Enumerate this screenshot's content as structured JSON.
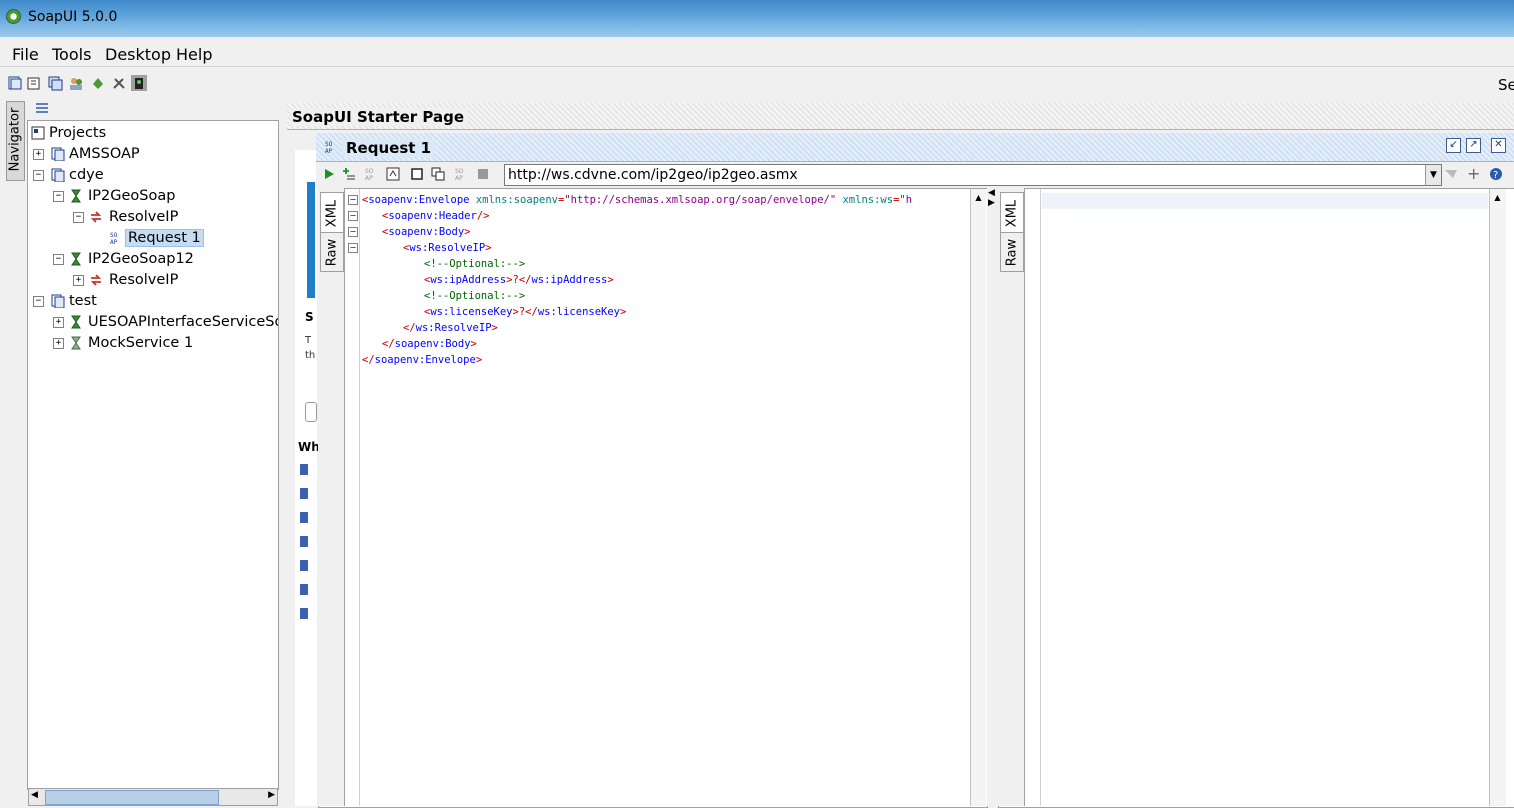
{
  "app": {
    "title": "SoapUI 5.0.0"
  },
  "menu": {
    "file": "File",
    "tools": "Tools",
    "desktop": "Desktop",
    "help": "Help"
  },
  "toolbar": {
    "search_label": "Se"
  },
  "navigator": {
    "tab_label": "Navigator",
    "root": "Projects",
    "nodes": {
      "amssoap": "AMSSOAP",
      "cdye": "cdye",
      "ip2geosoap": "IP2GeoSoap",
      "resolveip": "ResolveIP",
      "request1": "Request 1",
      "ip2geosoap12": "IP2GeoSoap12",
      "resolveip12": "ResolveIP",
      "test": "test",
      "uesoap": "UESOAPInterfaceServiceSoap",
      "mock": "MockService 1"
    }
  },
  "starter": {
    "title": "SoapUI Starter Page"
  },
  "request": {
    "title": "Request 1",
    "endpoint": "http://ws.cdvne.com/ip2geo/ip2geo.asmx",
    "left_tabs": {
      "xml": "XML",
      "raw": "Raw"
    },
    "right_tabs": {
      "xml": "XML",
      "raw": "Raw"
    }
  },
  "xml": {
    "l1_open": "<",
    "l1_tag": "soapenv:Envelope",
    "l1_attr1": " xmlns:soapenv",
    "l1_eq1": "=",
    "l1_val1": "\"http://schemas.xmlsoap.org/soap/envelope/\"",
    "l1_attr2": " xmlns:ws",
    "l1_eq2": "=",
    "l1_val2": "\"h",
    "l2_open": "<",
    "l2_tag": "soapenv:Header",
    "l2_close": "/>",
    "l3_open": "<",
    "l3_tag": "soapenv:Body",
    "l3_close": ">",
    "l4_open": "<",
    "l4_tag": "ws:ResolveIP",
    "l4_close": ">",
    "l5": "<!--Optional:-->",
    "l6_open": "<",
    "l6_tag": "ws:ipAddress",
    "l6_mid": ">?</",
    "l6_tag2": "ws:ipAddress",
    "l6_close": ">",
    "l7": "<!--Optional:-->",
    "l8_open": "<",
    "l8_tag": "ws:licenseKey",
    "l8_mid": ">?</",
    "l8_tag2": "ws:licenseKey",
    "l8_close": ">",
    "l9_open": "</",
    "l9_tag": "ws:ResolveIP",
    "l9_close": ">",
    "l10_open": "</",
    "l10_tag": "soapenv:Body",
    "l10_close": ">",
    "l11_open": "</",
    "l11_tag": "soapenv:Envelope",
    "l11_close": ">"
  },
  "colors": {
    "title_bar": "#5da2da",
    "selection": "#c5dcf3",
    "xml_tag": "#0000ff",
    "xml_attr": "#008080",
    "xml_value": "#8a008a"
  }
}
